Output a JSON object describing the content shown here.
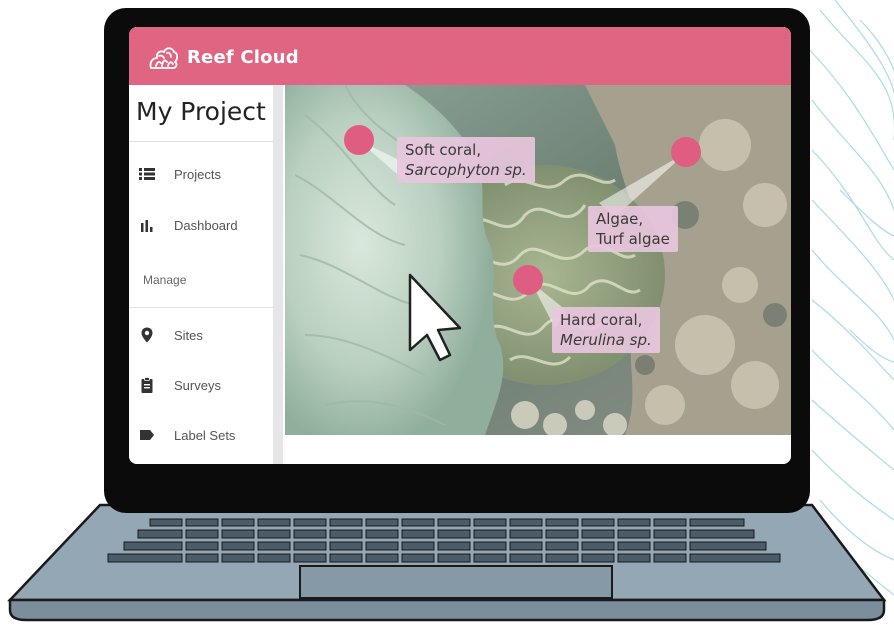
{
  "app": {
    "name": "Reef Cloud",
    "brand_color": "#df6583",
    "logo_icon": "coral-logo-icon"
  },
  "sidebar": {
    "project_title": "My Project",
    "items": [
      {
        "label": "Projects",
        "icon": "list-icon"
      },
      {
        "label": "Dashboard",
        "icon": "bar-chart-icon"
      }
    ],
    "section_label": "Manage",
    "manage_items": [
      {
        "label": "Sites",
        "icon": "map-pin-icon"
      },
      {
        "label": "Surveys",
        "icon": "clipboard-icon"
      },
      {
        "label": "Label Sets",
        "icon": "tag-icon"
      }
    ]
  },
  "annotations": [
    {
      "line1": "Soft coral,",
      "line2": "Sarcophyton sp."
    },
    {
      "line1": "Algae,",
      "line2": "Turf algae"
    },
    {
      "line1": "Hard coral,",
      "line2": "Merulina sp."
    }
  ],
  "colors": {
    "marker": "#df5d81",
    "label_bg": "#e8c6dd",
    "laptop_body": "#93a7b5"
  }
}
